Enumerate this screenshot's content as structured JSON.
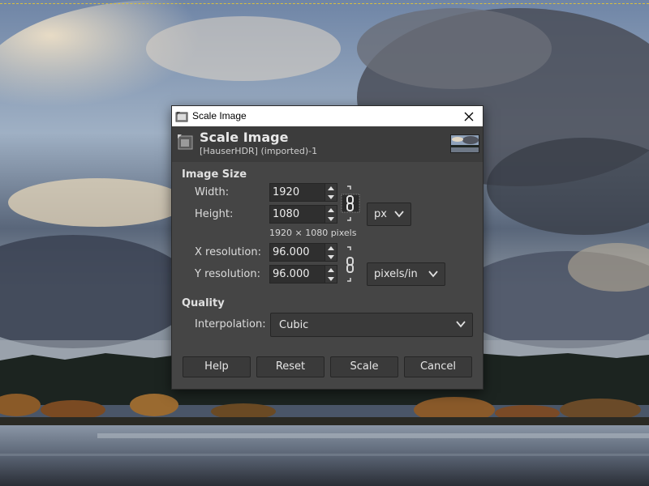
{
  "window": {
    "title": "Scale Image"
  },
  "header": {
    "title": "Scale Image",
    "subtitle": "[HauserHDR] (imported)-1"
  },
  "image_size": {
    "section_label": "Image Size",
    "width_label": "Width:",
    "width_value": "1920",
    "height_label": "Height:",
    "height_value": "1080",
    "size_unit": "px",
    "pixel_summary": "1920 × 1080 pixels",
    "xres_label": "X resolution:",
    "xres_value": "96.000",
    "yres_label": "Y resolution:",
    "yres_value": "96.000",
    "res_unit": "pixels/in"
  },
  "quality": {
    "section_label": "Quality",
    "interp_label": "Interpolation:",
    "interp_value": "Cubic"
  },
  "buttons": {
    "help": "Help",
    "reset": "Reset",
    "scale": "Scale",
    "cancel": "Cancel"
  },
  "icons": {
    "app": "gimp-app-icon",
    "close": "close-icon",
    "header": "scale-image-icon",
    "chain_size": "chain-link-icon",
    "chain_res": "chain-link-icon",
    "spin_up": "arrow-up-icon",
    "spin_down": "arrow-down-icon",
    "dropdown": "chevron-down-icon"
  }
}
